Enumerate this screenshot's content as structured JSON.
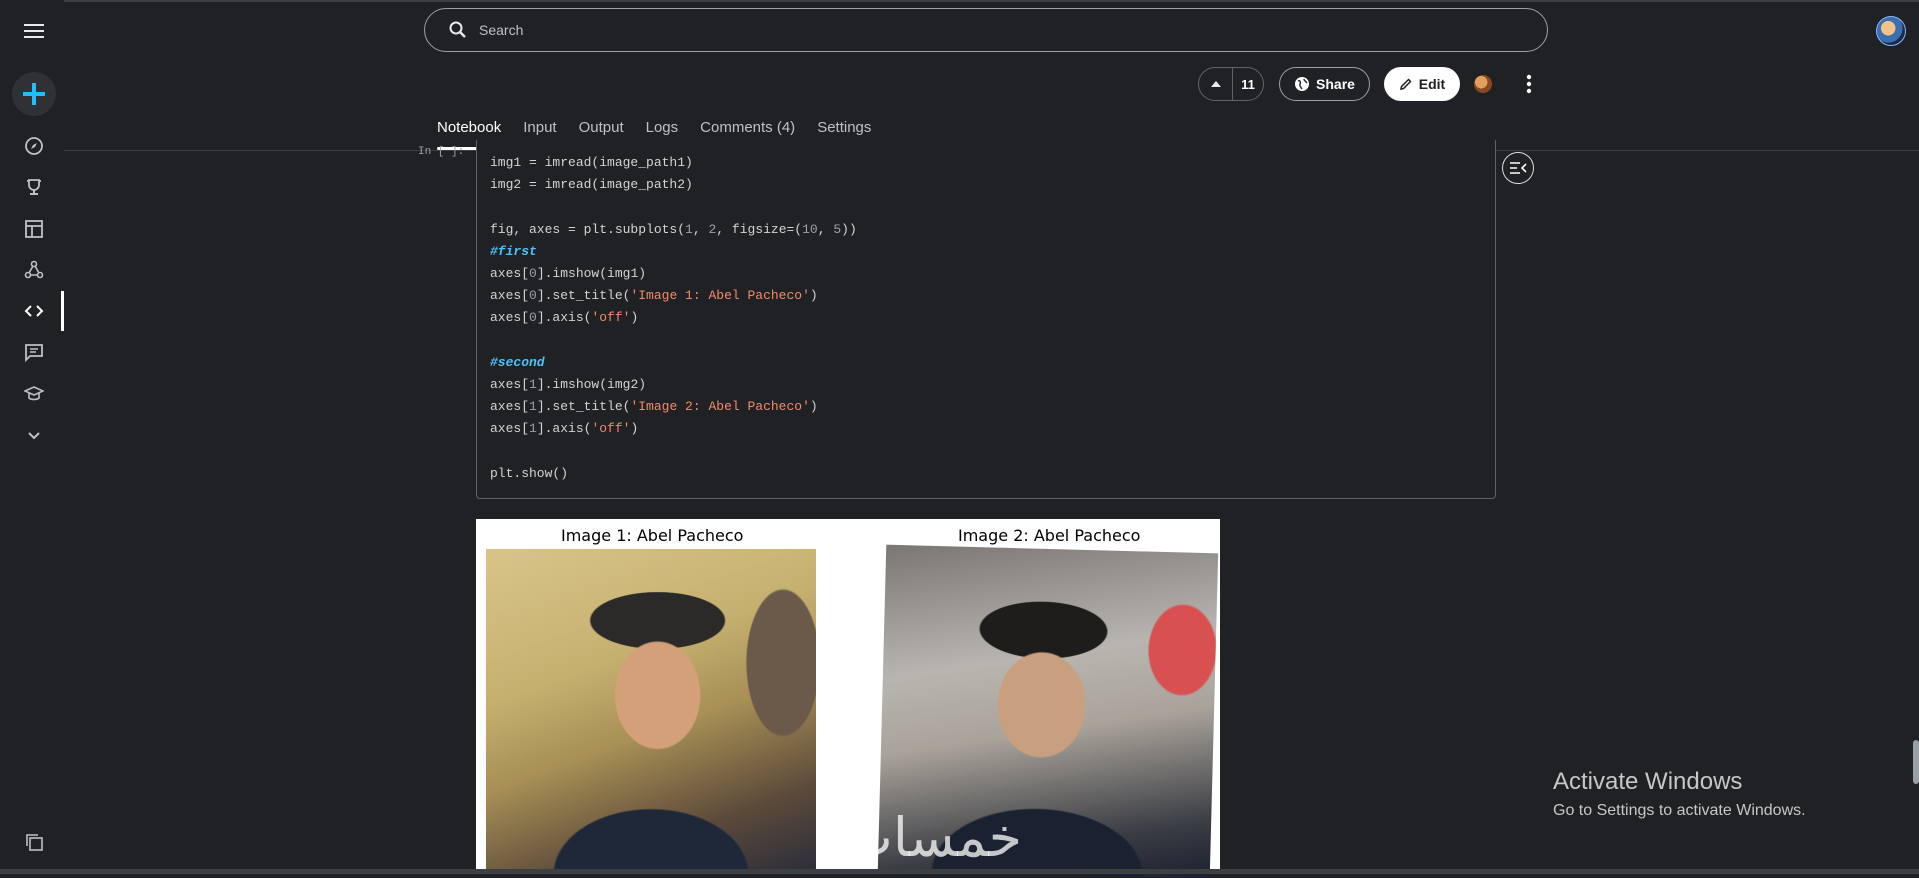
{
  "search": {
    "placeholder": "Search"
  },
  "toolbar": {
    "vote_count": "11",
    "share_label": "Share",
    "edit_label": "Edit"
  },
  "tabs": [
    {
      "label": "Notebook"
    },
    {
      "label": "Input"
    },
    {
      "label": "Output"
    },
    {
      "label": "Logs"
    },
    {
      "label": "Comments (4)"
    },
    {
      "label": "Settings"
    }
  ],
  "cell": {
    "in_label": "In [ ]:"
  },
  "code": {
    "l1_a": "img1 = imread(image_path1)",
    "l2_a": "img2 = imread(image_path2)",
    "l3_a": "fig, axes = plt.subplots(",
    "l3_n1": "1",
    "l3_c": ", ",
    "l3_n2": "2",
    "l3_d": ", figsize=(",
    "l3_n3": "10",
    "l3_e": ", ",
    "l3_n4": "5",
    "l3_f": "))",
    "l4_cmt": "#first",
    "l5_a": "axes[",
    "l5_n": "0",
    "l5_b": "].imshow(img1)",
    "l6_a": "axes[",
    "l6_n": "0",
    "l6_b": "].set_title(",
    "l6_s": "'Image 1: Abel Pacheco'",
    "l6_c": ")",
    "l7_a": "axes[",
    "l7_n": "0",
    "l7_b": "].axis(",
    "l7_s": "'off'",
    "l7_c": ")",
    "l8_cmt": "#second",
    "l9_a": "axes[",
    "l9_n": "1",
    "l9_b": "].imshow(img2)",
    "l10_a": "axes[",
    "l10_n": "1",
    "l10_b": "].set_title(",
    "l10_s": "'Image 2: Abel Pacheco'",
    "l10_c": ")",
    "l11_a": "axes[",
    "l11_n": "1",
    "l11_b": "].axis(",
    "l11_s": "'off'",
    "l11_c": ")",
    "l12_a": "plt.show()"
  },
  "output": {
    "title1": "Image 1: Abel Pacheco",
    "title2": "Image 2: Abel Pacheco"
  },
  "watermark": "خمسات",
  "activate": {
    "title": "Activate Windows",
    "subtitle": "Go to Settings to activate Windows."
  },
  "colors": {
    "background": "#202124",
    "string": "#f28b6b",
    "comment": "#4fc3f7",
    "accent_plus": "#20beff"
  },
  "icons": [
    "menu-icon",
    "plus-icon",
    "compass-icon",
    "trophy-icon",
    "table-icon",
    "models-icon",
    "code-icon",
    "discussion-icon",
    "learn-icon",
    "chevron-down-icon",
    "copy-icon",
    "search-icon",
    "upvote-icon",
    "globe-icon",
    "pencil-icon",
    "kebab-icon",
    "collapse-sidebar-icon"
  ]
}
